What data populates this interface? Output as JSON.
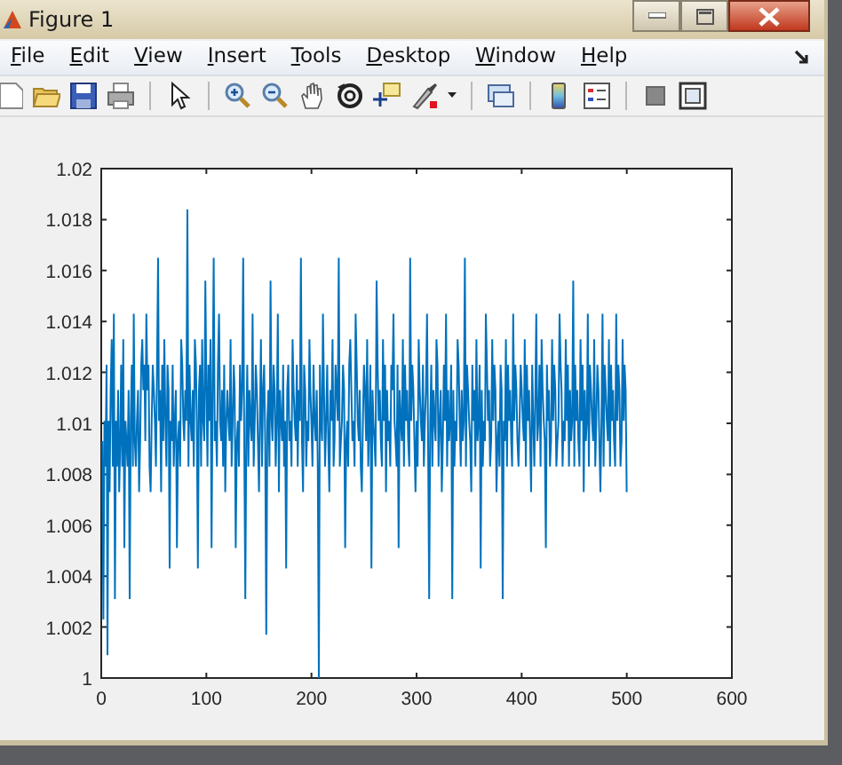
{
  "window": {
    "title": "Figure 1"
  },
  "menu": [
    "File",
    "Edit",
    "View",
    "Insert",
    "Tools",
    "Desktop",
    "Window",
    "Help"
  ],
  "axes": {
    "chart_data": {
      "type": "line",
      "xlim": [
        0,
        600
      ],
      "ylim": [
        1,
        1.02
      ],
      "xticks": [
        0,
        100,
        200,
        300,
        400,
        500,
        600
      ],
      "yticks": [
        1,
        1.002,
        1.004,
        1.006,
        1.008,
        1.01,
        1.012,
        1.014,
        1.016,
        1.018,
        1.02
      ],
      "x": [
        1,
        2,
        3,
        4,
        5,
        6,
        7,
        8,
        9,
        10,
        11,
        12,
        13,
        14,
        15,
        16,
        17,
        18,
        19,
        20,
        21,
        22,
        23,
        24,
        25,
        26,
        27,
        28,
        29,
        30,
        31,
        32,
        33,
        34,
        35,
        36,
        37,
        38,
        39,
        40,
        41,
        42,
        43,
        44,
        45,
        46,
        47,
        48,
        49,
        50,
        51,
        52,
        53,
        54,
        55,
        56,
        57,
        58,
        59,
        60,
        61,
        62,
        63,
        64,
        65,
        66,
        67,
        68,
        69,
        70,
        71,
        72,
        73,
        74,
        75,
        76,
        77,
        78,
        79,
        80,
        81,
        82,
        83,
        84,
        85,
        86,
        87,
        88,
        89,
        90,
        91,
        92,
        93,
        94,
        95,
        96,
        97,
        98,
        99,
        100,
        101,
        102,
        103,
        104,
        105,
        106,
        107,
        108,
        109,
        110,
        111,
        112,
        113,
        114,
        115,
        116,
        117,
        118,
        119,
        120,
        121,
        122,
        123,
        124,
        125,
        126,
        127,
        128,
        129,
        130,
        131,
        132,
        133,
        134,
        135,
        136,
        137,
        138,
        139,
        140,
        141,
        142,
        143,
        144,
        145,
        146,
        147,
        148,
        149,
        150,
        151,
        152,
        153,
        154,
        155,
        156,
        157,
        158,
        159,
        160,
        161,
        162,
        163,
        164,
        165,
        166,
        167,
        168,
        169,
        170,
        171,
        172,
        173,
        174,
        175,
        176,
        177,
        178,
        179,
        180,
        181,
        182,
        183,
        184,
        185,
        186,
        187,
        188,
        189,
        190,
        191,
        192,
        193,
        194,
        195,
        196,
        197,
        198,
        199,
        200,
        201,
        202,
        203,
        204,
        205,
        206,
        207,
        208,
        209,
        210,
        211,
        212,
        213,
        214,
        215,
        216,
        217,
        218,
        219,
        220,
        221,
        222,
        223,
        224,
        225,
        226,
        227,
        228,
        229,
        230,
        231,
        232,
        233,
        234,
        235,
        236,
        237,
        238,
        239,
        240,
        241,
        242,
        243,
        244,
        245,
        246,
        247,
        248,
        249,
        250,
        251,
        252,
        253,
        254,
        255,
        256,
        257,
        258,
        259,
        260,
        261,
        262,
        263,
        264,
        265,
        266,
        267,
        268,
        269,
        270,
        271,
        272,
        273,
        274,
        275,
        276,
        277,
        278,
        279,
        280,
        281,
        282,
        283,
        284,
        285,
        286,
        287,
        288,
        289,
        290,
        291,
        292,
        293,
        294,
        295,
        296,
        297,
        298,
        299,
        300,
        301,
        302,
        303,
        304,
        305,
        306,
        307,
        308,
        309,
        310,
        311,
        312,
        313,
        314,
        315,
        316,
        317,
        318,
        319,
        320,
        321,
        322,
        323,
        324,
        325,
        326,
        327,
        328,
        329,
        330,
        331,
        332,
        333,
        334,
        335,
        336,
        337,
        338,
        339,
        340,
        341,
        342,
        343,
        344,
        345,
        346,
        347,
        348,
        349,
        350,
        351,
        352,
        353,
        354,
        355,
        356,
        357,
        358,
        359,
        360,
        361,
        362,
        363,
        364,
        365,
        366,
        367,
        368,
        369,
        370,
        371,
        372,
        373,
        374,
        375,
        376,
        377,
        378,
        379,
        380,
        381,
        382,
        383,
        384,
        385,
        386,
        387,
        388,
        389,
        390,
        391,
        392,
        393,
        394,
        395,
        396,
        397,
        398,
        399,
        400,
        401,
        402,
        403,
        404,
        405,
        406,
        407,
        408,
        409,
        410,
        411,
        412,
        413,
        414,
        415,
        416,
        417,
        418,
        419,
        420,
        421,
        422,
        423,
        424,
        425,
        426,
        427,
        428,
        429,
        430,
        431,
        432,
        433,
        434,
        435,
        436,
        437,
        438,
        439,
        440,
        441,
        442,
        443,
        444,
        445,
        446,
        447,
        448,
        449,
        450,
        451,
        452,
        453,
        454,
        455,
        456,
        457,
        458,
        459,
        460,
        461,
        462,
        463,
        464,
        465,
        466,
        467,
        468,
        469,
        470,
        471,
        472,
        473,
        474,
        475,
        476,
        477,
        478,
        479,
        480,
        481,
        482,
        483,
        484,
        485,
        486,
        487,
        488,
        489,
        490,
        491,
        492,
        493,
        494,
        495,
        496,
        497,
        498,
        499,
        500
      ],
      "series": [
        {
          "color": "#0072bd",
          "values": [
            1.0093,
            1.0023,
            1.0101,
            1.0083,
            1.0123,
            1.0009,
            1.0101,
            1.0073,
            1.0113,
            1.0133,
            1.0083,
            1.0143,
            1.0031,
            1.0101,
            1.0083,
            1.0113,
            1.0073,
            1.0093,
            1.0123,
            1.0083,
            1.0133,
            1.0051,
            1.0101,
            1.0093,
            1.0083,
            1.0113,
            1.0031,
            1.0101,
            1.0123,
            1.0083,
            1.0143,
            1.0093,
            1.0083,
            1.0101,
            1.0113,
            1.0073,
            1.0093,
            1.0123,
            1.0133,
            1.0113,
            1.0123,
            1.0093,
            1.0143,
            1.0113,
            1.0123,
            1.0083,
            1.0073,
            1.0101,
            1.0123,
            1.0113,
            1.0101,
            1.0083,
            1.0123,
            1.0165,
            1.0101,
            1.0113,
            1.0073,
            1.0123,
            1.0093,
            1.0133,
            1.0101,
            1.0083,
            1.0123,
            1.0113,
            1.0043,
            1.0101,
            1.0093,
            1.0123,
            1.0083,
            1.0101,
            1.0113,
            1.0051,
            1.0093,
            1.0101,
            1.0083,
            1.0133,
            1.0123,
            1.0101,
            1.0093,
            1.0113,
            1.0101,
            1.0184,
            1.0083,
            1.0123,
            1.0101,
            1.0093,
            1.0113,
            1.0083,
            1.0133,
            1.0123,
            1.0101,
            1.0043,
            1.0113,
            1.0123,
            1.0083,
            1.0133,
            1.0101,
            1.0093,
            1.0156,
            1.0113,
            1.0083,
            1.0123,
            1.0101,
            1.0133,
            1.0051,
            1.0113,
            1.0165,
            1.0093,
            1.0101,
            1.0083,
            1.0123,
            1.0143,
            1.0101,
            1.0093,
            1.0113,
            1.0083,
            1.0123,
            1.0073,
            1.0101,
            1.0113,
            1.0101,
            1.0093,
            1.0133,
            1.0083,
            1.0101,
            1.0123,
            1.0113,
            1.0051,
            1.0093,
            1.0101,
            1.0083,
            1.0123,
            1.0101,
            1.0113,
            1.0165,
            1.0093,
            1.0031,
            1.0101,
            1.0123,
            1.0083,
            1.0113,
            1.0101,
            1.0093,
            1.0143,
            1.0083,
            1.0101,
            1.0123,
            1.0113,
            1.0093,
            1.0073,
            1.0101,
            1.0133,
            1.0083,
            1.0113,
            1.0123,
            1.0093,
            1.0017,
            1.0101,
            1.0113,
            1.0083,
            1.0156,
            1.0101,
            1.0093,
            1.0123,
            1.0113,
            1.0083,
            1.0101,
            1.0143,
            1.0073,
            1.0113,
            1.0101,
            1.0093,
            1.0123,
            1.0083,
            1.0101,
            1.0043,
            1.0113,
            1.0123,
            1.0093,
            1.0101,
            1.0083,
            1.0133,
            1.0113,
            1.0101,
            1.0093,
            1.0123,
            1.0083,
            1.0113,
            1.0101,
            1.0165,
            1.0093,
            1.0073,
            1.0123,
            1.0113,
            1.0083,
            1.0101,
            1.0093,
            1.0133,
            1.0113,
            1.0101,
            1.0083,
            1.0123,
            1.0101,
            1.0093,
            1.0113,
            1.0083,
            1.0,
            1.0123,
            1.0101,
            1.0093,
            1.0143,
            1.0113,
            1.0083,
            1.0101,
            1.0123,
            1.0093,
            1.0073,
            1.0113,
            1.0101,
            1.0133,
            1.0083,
            1.0093,
            1.0123,
            1.0113,
            1.0101,
            1.0165,
            1.0083,
            1.0093,
            1.0101,
            1.0123,
            1.0113,
            1.0051,
            1.0093,
            1.0101,
            1.0083,
            1.0123,
            1.0133,
            1.0113,
            1.0093,
            1.0101,
            1.0083,
            1.0143,
            1.0123,
            1.0101,
            1.0093,
            1.0113,
            1.0083,
            1.0073,
            1.0101,
            1.0123,
            1.0113,
            1.0093,
            1.0133,
            1.0083,
            1.0101,
            1.0123,
            1.0043,
            1.0113,
            1.0101,
            1.0093,
            1.0083,
            1.0156,
            1.0123,
            1.0101,
            1.0113,
            1.0093,
            1.0083,
            1.0133,
            1.0101,
            1.0123,
            1.0073,
            1.0113,
            1.0093,
            1.0101,
            1.0083,
            1.0123,
            1.0113,
            1.0143,
            1.0101,
            1.0093,
            1.0083,
            1.0123,
            1.0051,
            1.0113,
            1.0101,
            1.0093,
            1.0133,
            1.0083,
            1.0123,
            1.0101,
            1.0113,
            1.0093,
            1.0083,
            1.0165,
            1.0101,
            1.0123,
            1.0113,
            1.0093,
            1.0073,
            1.0101,
            1.0083,
            1.0133,
            1.0113,
            1.0101,
            1.0093,
            1.0123,
            1.0083,
            1.0101,
            1.0113,
            1.0143,
            1.0093,
            1.0031,
            1.0101,
            1.0123,
            1.0083,
            1.0113,
            1.0101,
            1.0093,
            1.0133,
            1.0123,
            1.0083,
            1.0101,
            1.0113,
            1.0073,
            1.0093,
            1.0123,
            1.0101,
            1.0143,
            1.0083,
            1.0113,
            1.0093,
            1.0101,
            1.0123,
            1.0031,
            1.0113,
            1.0083,
            1.0101,
            1.0093,
            1.0133,
            1.0123,
            1.0101,
            1.0083,
            1.0113,
            1.0093,
            1.0101,
            1.0165,
            1.0083,
            1.0123,
            1.0113,
            1.0101,
            1.0093,
            1.0073,
            1.0123,
            1.0101,
            1.0113,
            1.0083,
            1.0133,
            1.0093,
            1.0101,
            1.0123,
            1.0043,
            1.0113,
            1.0083,
            1.0101,
            1.0093,
            1.0143,
            1.0123,
            1.0101,
            1.0113,
            1.0083,
            1.0093,
            1.0133,
            1.0101,
            1.0123,
            1.0113,
            1.0073,
            1.0093,
            1.0101,
            1.0083,
            1.0123,
            1.0113,
            1.0031,
            1.0101,
            1.0093,
            1.0133,
            1.0083,
            1.0123,
            1.0101,
            1.0113,
            1.0093,
            1.0083,
            1.0143,
            1.0101,
            1.0123,
            1.0113,
            1.0093,
            1.0083,
            1.0101,
            1.0123,
            1.0113,
            1.0101,
            1.0093,
            1.0133,
            1.0083,
            1.0123,
            1.0101,
            1.0113,
            1.0093,
            1.0073,
            1.0123,
            1.0101,
            1.0083,
            1.0113,
            1.0143,
            1.0093,
            1.0101,
            1.0123,
            1.0083,
            1.0133,
            1.0113,
            1.0101,
            1.0093,
            1.0051,
            1.0123,
            1.0101,
            1.0113,
            1.0083,
            1.0093,
            1.0133,
            1.0101,
            1.0123,
            1.0113,
            1.0083,
            1.0093,
            1.0101,
            1.0143,
            1.0123,
            1.0113,
            1.0083,
            1.0101,
            1.0093,
            1.0133,
            1.0101,
            1.0123,
            1.0083,
            1.0113,
            1.0093,
            1.0101,
            1.0156,
            1.0083,
            1.0123,
            1.0101,
            1.0113,
            1.0093,
            1.0083,
            1.0133,
            1.0101,
            1.0123,
            1.0073,
            1.0113,
            1.0093,
            1.0101,
            1.0143,
            1.0083,
            1.0123,
            1.0113,
            1.0101,
            1.0093,
            1.0133,
            1.0083,
            1.0101,
            1.0123,
            1.0113,
            1.0093,
            1.0073,
            1.0101,
            1.0143,
            1.0083,
            1.0123,
            1.0113,
            1.0101,
            1.0093,
            1.0133,
            1.0083,
            1.0123,
            1.0101,
            1.0113,
            1.0093,
            1.0083,
            1.0143,
            1.0101,
            1.0123,
            1.0113,
            1.0083,
            1.0093,
            1.0133,
            1.0101,
            1.0123,
            1.0113,
            1.0073
          ]
        }
      ]
    }
  }
}
